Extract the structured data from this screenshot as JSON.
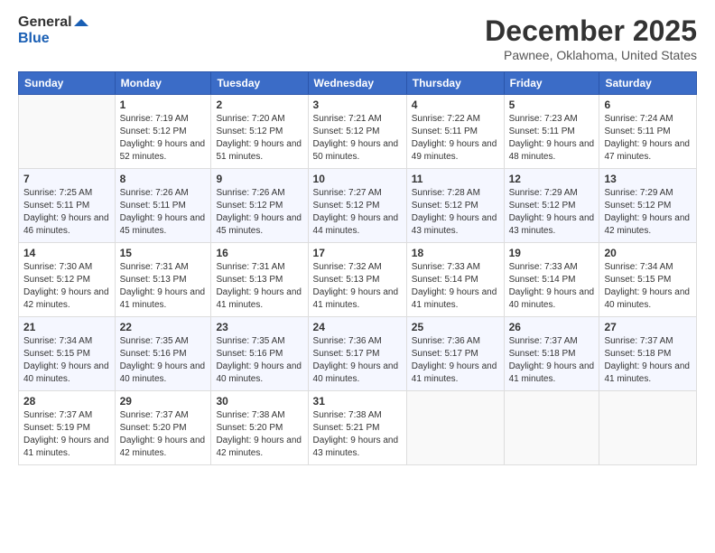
{
  "header": {
    "logo_line1": "General",
    "logo_line2": "Blue",
    "month": "December 2025",
    "location": "Pawnee, Oklahoma, United States"
  },
  "days_of_week": [
    "Sunday",
    "Monday",
    "Tuesday",
    "Wednesday",
    "Thursday",
    "Friday",
    "Saturday"
  ],
  "weeks": [
    [
      {
        "day": "",
        "sunrise": "",
        "sunset": "",
        "daylight": ""
      },
      {
        "day": "1",
        "sunrise": "Sunrise: 7:19 AM",
        "sunset": "Sunset: 5:12 PM",
        "daylight": "Daylight: 9 hours and 52 minutes."
      },
      {
        "day": "2",
        "sunrise": "Sunrise: 7:20 AM",
        "sunset": "Sunset: 5:12 PM",
        "daylight": "Daylight: 9 hours and 51 minutes."
      },
      {
        "day": "3",
        "sunrise": "Sunrise: 7:21 AM",
        "sunset": "Sunset: 5:12 PM",
        "daylight": "Daylight: 9 hours and 50 minutes."
      },
      {
        "day": "4",
        "sunrise": "Sunrise: 7:22 AM",
        "sunset": "Sunset: 5:11 PM",
        "daylight": "Daylight: 9 hours and 49 minutes."
      },
      {
        "day": "5",
        "sunrise": "Sunrise: 7:23 AM",
        "sunset": "Sunset: 5:11 PM",
        "daylight": "Daylight: 9 hours and 48 minutes."
      },
      {
        "day": "6",
        "sunrise": "Sunrise: 7:24 AM",
        "sunset": "Sunset: 5:11 PM",
        "daylight": "Daylight: 9 hours and 47 minutes."
      }
    ],
    [
      {
        "day": "7",
        "sunrise": "Sunrise: 7:25 AM",
        "sunset": "Sunset: 5:11 PM",
        "daylight": "Daylight: 9 hours and 46 minutes."
      },
      {
        "day": "8",
        "sunrise": "Sunrise: 7:26 AM",
        "sunset": "Sunset: 5:11 PM",
        "daylight": "Daylight: 9 hours and 45 minutes."
      },
      {
        "day": "9",
        "sunrise": "Sunrise: 7:26 AM",
        "sunset": "Sunset: 5:12 PM",
        "daylight": "Daylight: 9 hours and 45 minutes."
      },
      {
        "day": "10",
        "sunrise": "Sunrise: 7:27 AM",
        "sunset": "Sunset: 5:12 PM",
        "daylight": "Daylight: 9 hours and 44 minutes."
      },
      {
        "day": "11",
        "sunrise": "Sunrise: 7:28 AM",
        "sunset": "Sunset: 5:12 PM",
        "daylight": "Daylight: 9 hours and 43 minutes."
      },
      {
        "day": "12",
        "sunrise": "Sunrise: 7:29 AM",
        "sunset": "Sunset: 5:12 PM",
        "daylight": "Daylight: 9 hours and 43 minutes."
      },
      {
        "day": "13",
        "sunrise": "Sunrise: 7:29 AM",
        "sunset": "Sunset: 5:12 PM",
        "daylight": "Daylight: 9 hours and 42 minutes."
      }
    ],
    [
      {
        "day": "14",
        "sunrise": "Sunrise: 7:30 AM",
        "sunset": "Sunset: 5:12 PM",
        "daylight": "Daylight: 9 hours and 42 minutes."
      },
      {
        "day": "15",
        "sunrise": "Sunrise: 7:31 AM",
        "sunset": "Sunset: 5:13 PM",
        "daylight": "Daylight: 9 hours and 41 minutes."
      },
      {
        "day": "16",
        "sunrise": "Sunrise: 7:31 AM",
        "sunset": "Sunset: 5:13 PM",
        "daylight": "Daylight: 9 hours and 41 minutes."
      },
      {
        "day": "17",
        "sunrise": "Sunrise: 7:32 AM",
        "sunset": "Sunset: 5:13 PM",
        "daylight": "Daylight: 9 hours and 41 minutes."
      },
      {
        "day": "18",
        "sunrise": "Sunrise: 7:33 AM",
        "sunset": "Sunset: 5:14 PM",
        "daylight": "Daylight: 9 hours and 41 minutes."
      },
      {
        "day": "19",
        "sunrise": "Sunrise: 7:33 AM",
        "sunset": "Sunset: 5:14 PM",
        "daylight": "Daylight: 9 hours and 40 minutes."
      },
      {
        "day": "20",
        "sunrise": "Sunrise: 7:34 AM",
        "sunset": "Sunset: 5:15 PM",
        "daylight": "Daylight: 9 hours and 40 minutes."
      }
    ],
    [
      {
        "day": "21",
        "sunrise": "Sunrise: 7:34 AM",
        "sunset": "Sunset: 5:15 PM",
        "daylight": "Daylight: 9 hours and 40 minutes."
      },
      {
        "day": "22",
        "sunrise": "Sunrise: 7:35 AM",
        "sunset": "Sunset: 5:16 PM",
        "daylight": "Daylight: 9 hours and 40 minutes."
      },
      {
        "day": "23",
        "sunrise": "Sunrise: 7:35 AM",
        "sunset": "Sunset: 5:16 PM",
        "daylight": "Daylight: 9 hours and 40 minutes."
      },
      {
        "day": "24",
        "sunrise": "Sunrise: 7:36 AM",
        "sunset": "Sunset: 5:17 PM",
        "daylight": "Daylight: 9 hours and 40 minutes."
      },
      {
        "day": "25",
        "sunrise": "Sunrise: 7:36 AM",
        "sunset": "Sunset: 5:17 PM",
        "daylight": "Daylight: 9 hours and 41 minutes."
      },
      {
        "day": "26",
        "sunrise": "Sunrise: 7:37 AM",
        "sunset": "Sunset: 5:18 PM",
        "daylight": "Daylight: 9 hours and 41 minutes."
      },
      {
        "day": "27",
        "sunrise": "Sunrise: 7:37 AM",
        "sunset": "Sunset: 5:18 PM",
        "daylight": "Daylight: 9 hours and 41 minutes."
      }
    ],
    [
      {
        "day": "28",
        "sunrise": "Sunrise: 7:37 AM",
        "sunset": "Sunset: 5:19 PM",
        "daylight": "Daylight: 9 hours and 41 minutes."
      },
      {
        "day": "29",
        "sunrise": "Sunrise: 7:37 AM",
        "sunset": "Sunset: 5:20 PM",
        "daylight": "Daylight: 9 hours and 42 minutes."
      },
      {
        "day": "30",
        "sunrise": "Sunrise: 7:38 AM",
        "sunset": "Sunset: 5:20 PM",
        "daylight": "Daylight: 9 hours and 42 minutes."
      },
      {
        "day": "31",
        "sunrise": "Sunrise: 7:38 AM",
        "sunset": "Sunset: 5:21 PM",
        "daylight": "Daylight: 9 hours and 43 minutes."
      },
      {
        "day": "",
        "sunrise": "",
        "sunset": "",
        "daylight": ""
      },
      {
        "day": "",
        "sunrise": "",
        "sunset": "",
        "daylight": ""
      },
      {
        "day": "",
        "sunrise": "",
        "sunset": "",
        "daylight": ""
      }
    ]
  ]
}
